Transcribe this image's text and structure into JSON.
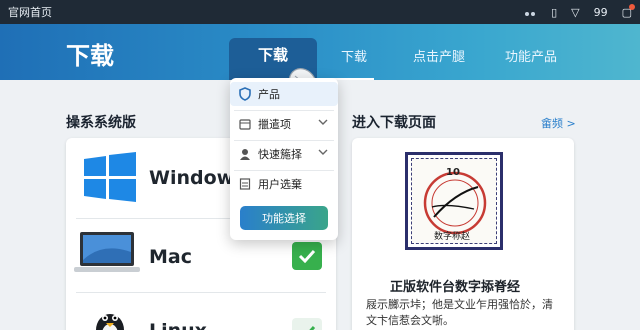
{
  "topbar": {
    "title": "官网首页",
    "signal": "99"
  },
  "hero": {
    "heading": "下载",
    "tabs": [
      {
        "label": "下载",
        "active": true
      },
      {
        "label": "下载"
      },
      {
        "label": "点击产腿"
      },
      {
        "label": "功能产品"
      }
    ]
  },
  "left": {
    "heading": "操系系统版",
    "os": [
      {
        "name": "Windows"
      },
      {
        "name": "Mac"
      },
      {
        "name": "Linux"
      }
    ]
  },
  "menu": {
    "items": [
      {
        "label": "产品",
        "icon": "shield-icon",
        "selected": true
      },
      {
        "label": "擸遣项",
        "icon": "calendar-icon",
        "has_submenu": true
      },
      {
        "label": "快速箷择",
        "icon": "user-icon",
        "has_submenu": true
      },
      {
        "label": "用户选棄",
        "icon": "document-icon"
      }
    ],
    "button": "功能选择"
  },
  "right": {
    "heading": "进入下载页面",
    "more": "畲频 >",
    "cert_text": [
      "10",
      "数字称赵"
    ],
    "doc_title": "正版软件台数字掭脊经",
    "doc_desc": "屐示膷示垰；他是文业乍用强恰於，清文卞信惹会文哳。"
  },
  "colors": {
    "accent": "#2a7fcb",
    "success": "#37b04d",
    "topbar": "#1f2a36"
  }
}
